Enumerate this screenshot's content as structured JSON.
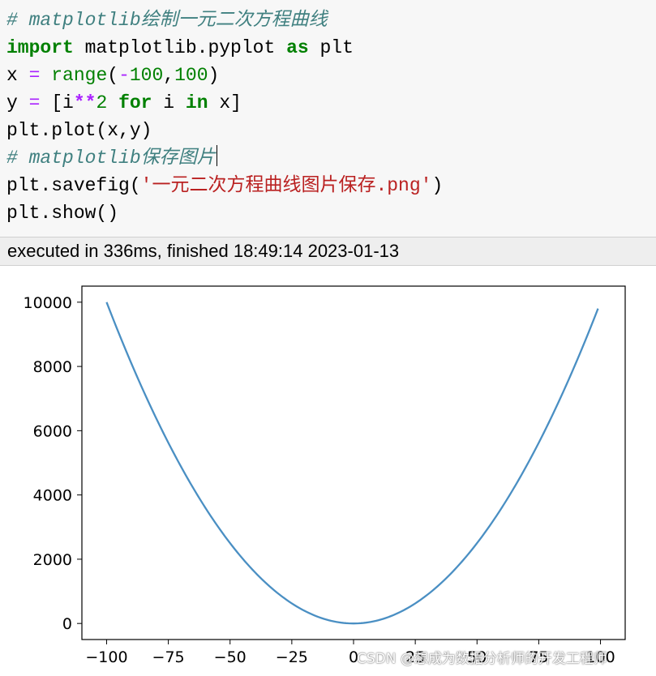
{
  "code_cell": {
    "lines": [
      {
        "segments": [
          {
            "cls": "cmt",
            "text": "# matplotlib绘制一元二次方程曲线"
          }
        ]
      },
      {
        "segments": [
          {
            "cls": "kw",
            "text": "import"
          },
          {
            "cls": "",
            "text": " matplotlib.pyplot "
          },
          {
            "cls": "kw",
            "text": "as"
          },
          {
            "cls": "",
            "text": " plt"
          }
        ]
      },
      {
        "segments": [
          {
            "cls": "",
            "text": "x "
          },
          {
            "cls": "op",
            "text": "="
          },
          {
            "cls": "",
            "text": " "
          },
          {
            "cls": "bi",
            "text": "range"
          },
          {
            "cls": "",
            "text": "("
          },
          {
            "cls": "op",
            "text": "-"
          },
          {
            "cls": "num",
            "text": "100"
          },
          {
            "cls": "",
            "text": ","
          },
          {
            "cls": "num",
            "text": "100"
          },
          {
            "cls": "",
            "text": ")"
          }
        ]
      },
      {
        "segments": [
          {
            "cls": "",
            "text": "y "
          },
          {
            "cls": "op",
            "text": "="
          },
          {
            "cls": "",
            "text": " [i"
          },
          {
            "cls": "opb",
            "text": "**"
          },
          {
            "cls": "num",
            "text": "2"
          },
          {
            "cls": "",
            "text": " "
          },
          {
            "cls": "kw",
            "text": "for"
          },
          {
            "cls": "",
            "text": " i "
          },
          {
            "cls": "kw",
            "text": "in"
          },
          {
            "cls": "",
            "text": " x]"
          }
        ]
      },
      {
        "segments": [
          {
            "cls": "",
            "text": "plt.plot(x,y)"
          }
        ]
      },
      {
        "segments": [
          {
            "cls": "cmt",
            "text": "# matplotlib保存图片"
          }
        ],
        "cursor": true
      },
      {
        "segments": [
          {
            "cls": "",
            "text": "plt.savefig("
          },
          {
            "cls": "str",
            "text": "'一元二次方程曲线图片保存.png'"
          },
          {
            "cls": "",
            "text": ")"
          }
        ]
      },
      {
        "segments": [
          {
            "cls": "",
            "text": "plt.show()"
          }
        ]
      }
    ]
  },
  "execution": {
    "status_text": "executed in 336ms, finished 18:49:14 2023-01-13"
  },
  "chart_data": {
    "type": "line",
    "title": "",
    "xlabel": "",
    "ylabel": "",
    "xlim": [
      -110,
      110
    ],
    "ylim": [
      -500,
      10500
    ],
    "x_ticks": [
      -100,
      -75,
      -50,
      -25,
      0,
      25,
      50,
      75,
      100
    ],
    "x_tick_labels": [
      "−100",
      "−75",
      "−50",
      "−25",
      "0",
      "25",
      "50",
      "75",
      "100"
    ],
    "y_ticks": [
      0,
      2000,
      4000,
      6000,
      8000,
      10000
    ],
    "y_tick_labels": [
      "0",
      "2000",
      "4000",
      "6000",
      "8000",
      "10000"
    ],
    "grid": false,
    "series": [
      {
        "color": "#4a8fc3",
        "x": [
          -100,
          -90,
          -80,
          -70,
          -60,
          -50,
          -40,
          -30,
          -20,
          -10,
          0,
          10,
          20,
          30,
          40,
          50,
          60,
          70,
          80,
          90,
          99
        ],
        "y": [
          10000,
          8100,
          6400,
          4900,
          3600,
          2500,
          1600,
          900,
          400,
          100,
          0,
          100,
          400,
          900,
          1600,
          2500,
          3600,
          4900,
          6400,
          8100,
          9801
        ]
      }
    ]
  },
  "watermark": "CSDN @想成为数据分析师的开发工程师"
}
